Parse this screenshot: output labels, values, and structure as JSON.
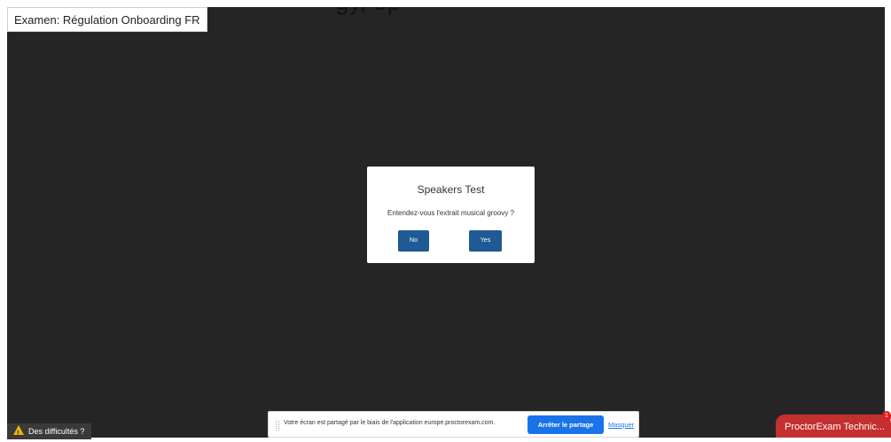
{
  "top_cut_text": "gy, ep",
  "exam": {
    "title": "Examen: Régulation Onboarding FR"
  },
  "modal": {
    "title": "Speakers Test",
    "question": "Entendez-vous l'extrait musical groovy ?",
    "no_label": "No",
    "yes_label": "Yes"
  },
  "help": {
    "label": "Des difficultés ?",
    "icon": "warning-icon"
  },
  "share_bar": {
    "message": "Votre écran est partagé par le biais de l'application europe.proctorexam.com.",
    "stop_label": "Arrêter le partage",
    "hide_label": "Masquer"
  },
  "chat": {
    "label": "ProctorExam Technic...",
    "badge": "1"
  },
  "colors": {
    "background": "#252525",
    "primary_button": "#1f5a94",
    "stop_button": "#1a73e8",
    "chat_tab": "#c42f2f",
    "warning": "#f0b400"
  }
}
